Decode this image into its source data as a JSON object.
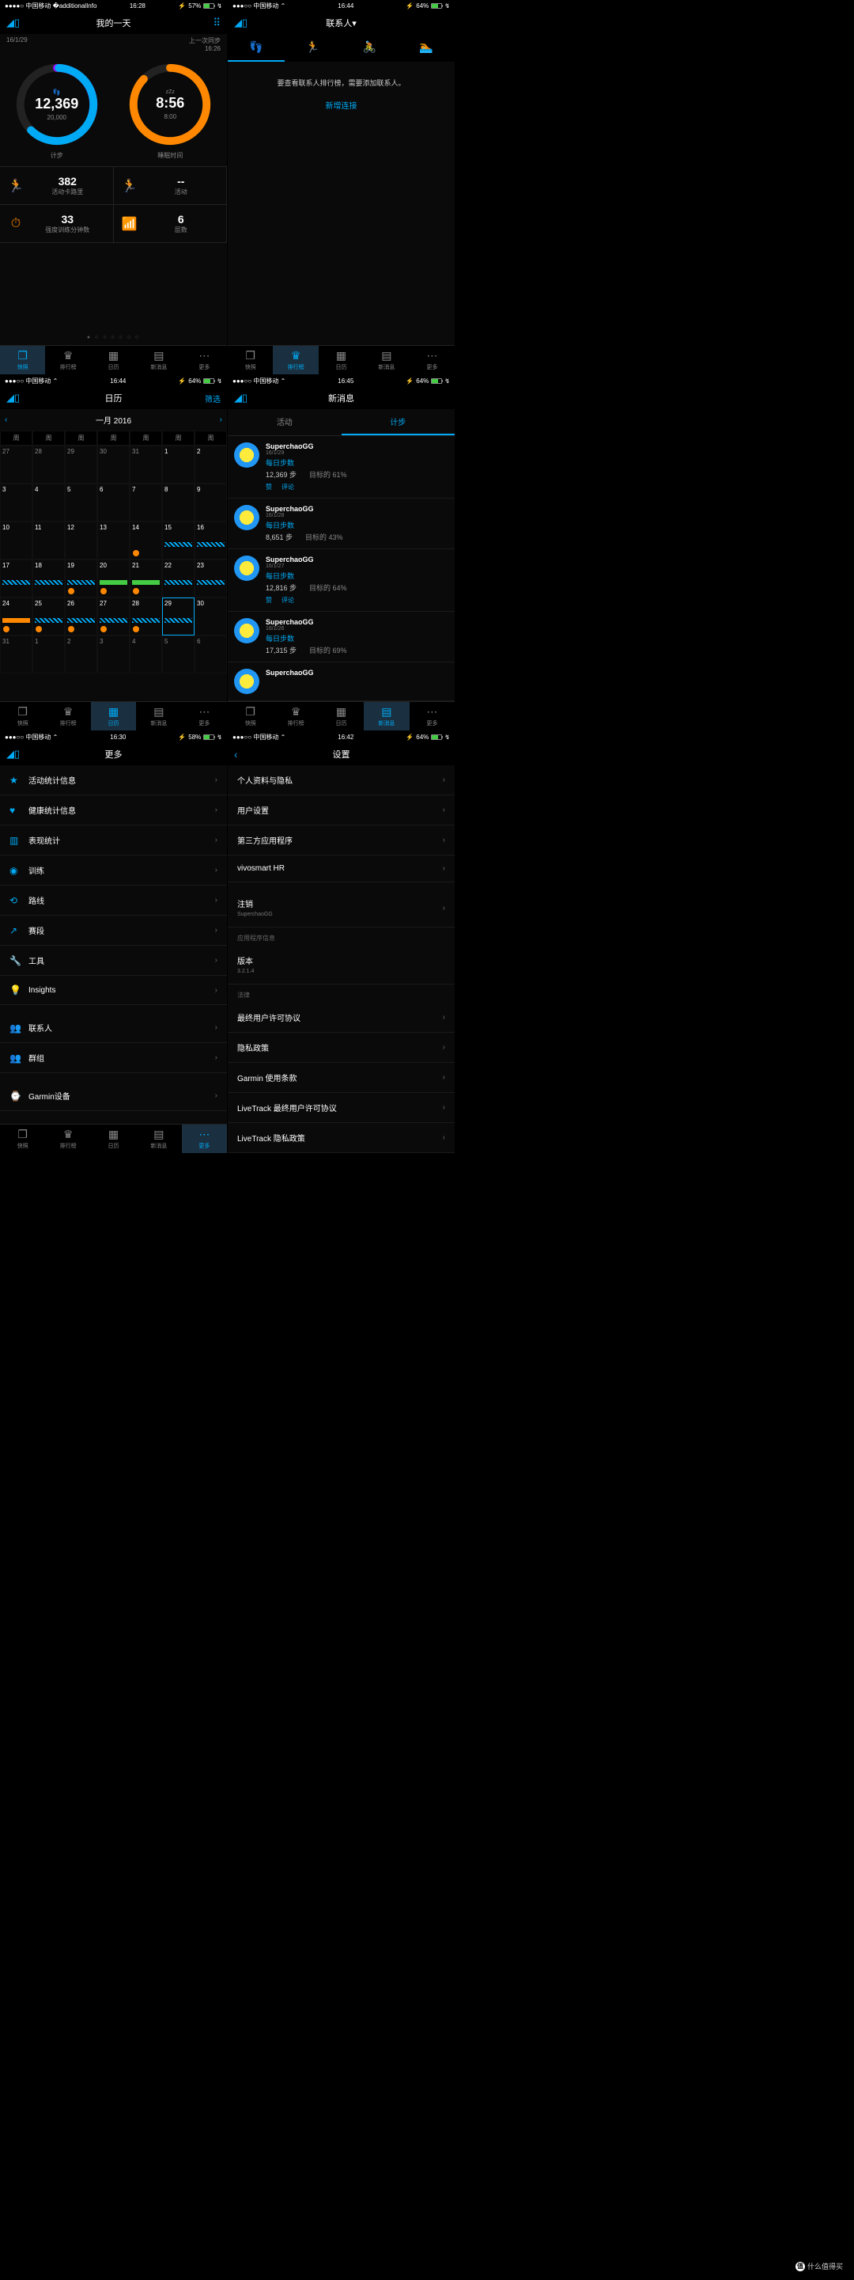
{
  "carrier": "中国移动",
  "watermark": "什么值得买",
  "screens": {
    "day": {
      "time": "16:28",
      "battery": "57%",
      "title": "我的一天",
      "date": "16/1/29",
      "sync_label": "上一次同步",
      "sync_time": "16:26",
      "steps": {
        "value": "12,369",
        "goal": "20,000",
        "label": "计步"
      },
      "sleep": {
        "value": "8:56",
        "goal": "8:00",
        "label": "睡眠时间"
      },
      "stats": [
        {
          "v": "382",
          "l": "活动卡路里"
        },
        {
          "v": "--",
          "l": "活动"
        },
        {
          "v": "33",
          "l": "强度训练分钟数"
        },
        {
          "v": "6",
          "l": "层数"
        }
      ]
    },
    "contacts": {
      "time": "16:44",
      "battery": "64%",
      "title": "联系人▾",
      "msg": "要查看联系人排行榜，需要添加联系人。",
      "link": "新增连接"
    },
    "cal": {
      "time": "16:44",
      "battery": "64%",
      "title": "日历",
      "filter": "筛选",
      "month": "一月 2016",
      "weekdays": [
        "周",
        "周",
        "周",
        "周",
        "周",
        "周",
        "周"
      ]
    },
    "news": {
      "time": "16:45",
      "battery": "64%",
      "title": "新消息",
      "tabs": [
        "活动",
        "计步"
      ],
      "posts": [
        {
          "name": "SuperchaoGG",
          "date": "16/1/29",
          "title": "每日步数",
          "steps": "12,369 步",
          "goal": "目标的 61%",
          "like": "赞",
          "comment": "评论"
        },
        {
          "name": "SuperchaoGG",
          "date": "16/1/28",
          "title": "每日步数",
          "steps": "8,651 步",
          "goal": "目标的 43%"
        },
        {
          "name": "SuperchaoGG",
          "date": "16/1/27",
          "title": "每日步数",
          "steps": "12,816 步",
          "goal": "目标的 64%",
          "like": "赞",
          "comment": "评论"
        },
        {
          "name": "SuperchaoGG",
          "date": "16/1/26",
          "title": "每日步数",
          "steps": "17,315 步",
          "goal": "目标的 69%"
        }
      ]
    },
    "more": {
      "time": "16:30",
      "battery": "58%",
      "title": "更多",
      "items": [
        "活动统计信息",
        "健康统计信息",
        "表现统计",
        "训练",
        "路线",
        "赛段",
        "工具",
        "Insights"
      ],
      "social": [
        "联系人",
        "群组"
      ],
      "device": "Garmin设备"
    },
    "settings": {
      "time": "16:42",
      "battery": "64%",
      "title": "设置",
      "items": [
        "个人资料与隐私",
        "用户设置",
        "第三方应用程序",
        "vivosmart HR"
      ],
      "logout": "注销",
      "logout_sub": "SuperchaoGG",
      "sect_app": "应用程序信息",
      "version_l": "版本",
      "version_v": "3.2.1.4",
      "sect_legal": "法律",
      "legal": [
        "最终用户许可协议",
        "隐私政策",
        "Garmin 使用条款",
        "LiveTrack 最终用户许可协议",
        "LiveTrack 隐私政策"
      ]
    }
  },
  "tabs": [
    "快照",
    "排行榜",
    "日历",
    "新消息",
    "更多"
  ]
}
